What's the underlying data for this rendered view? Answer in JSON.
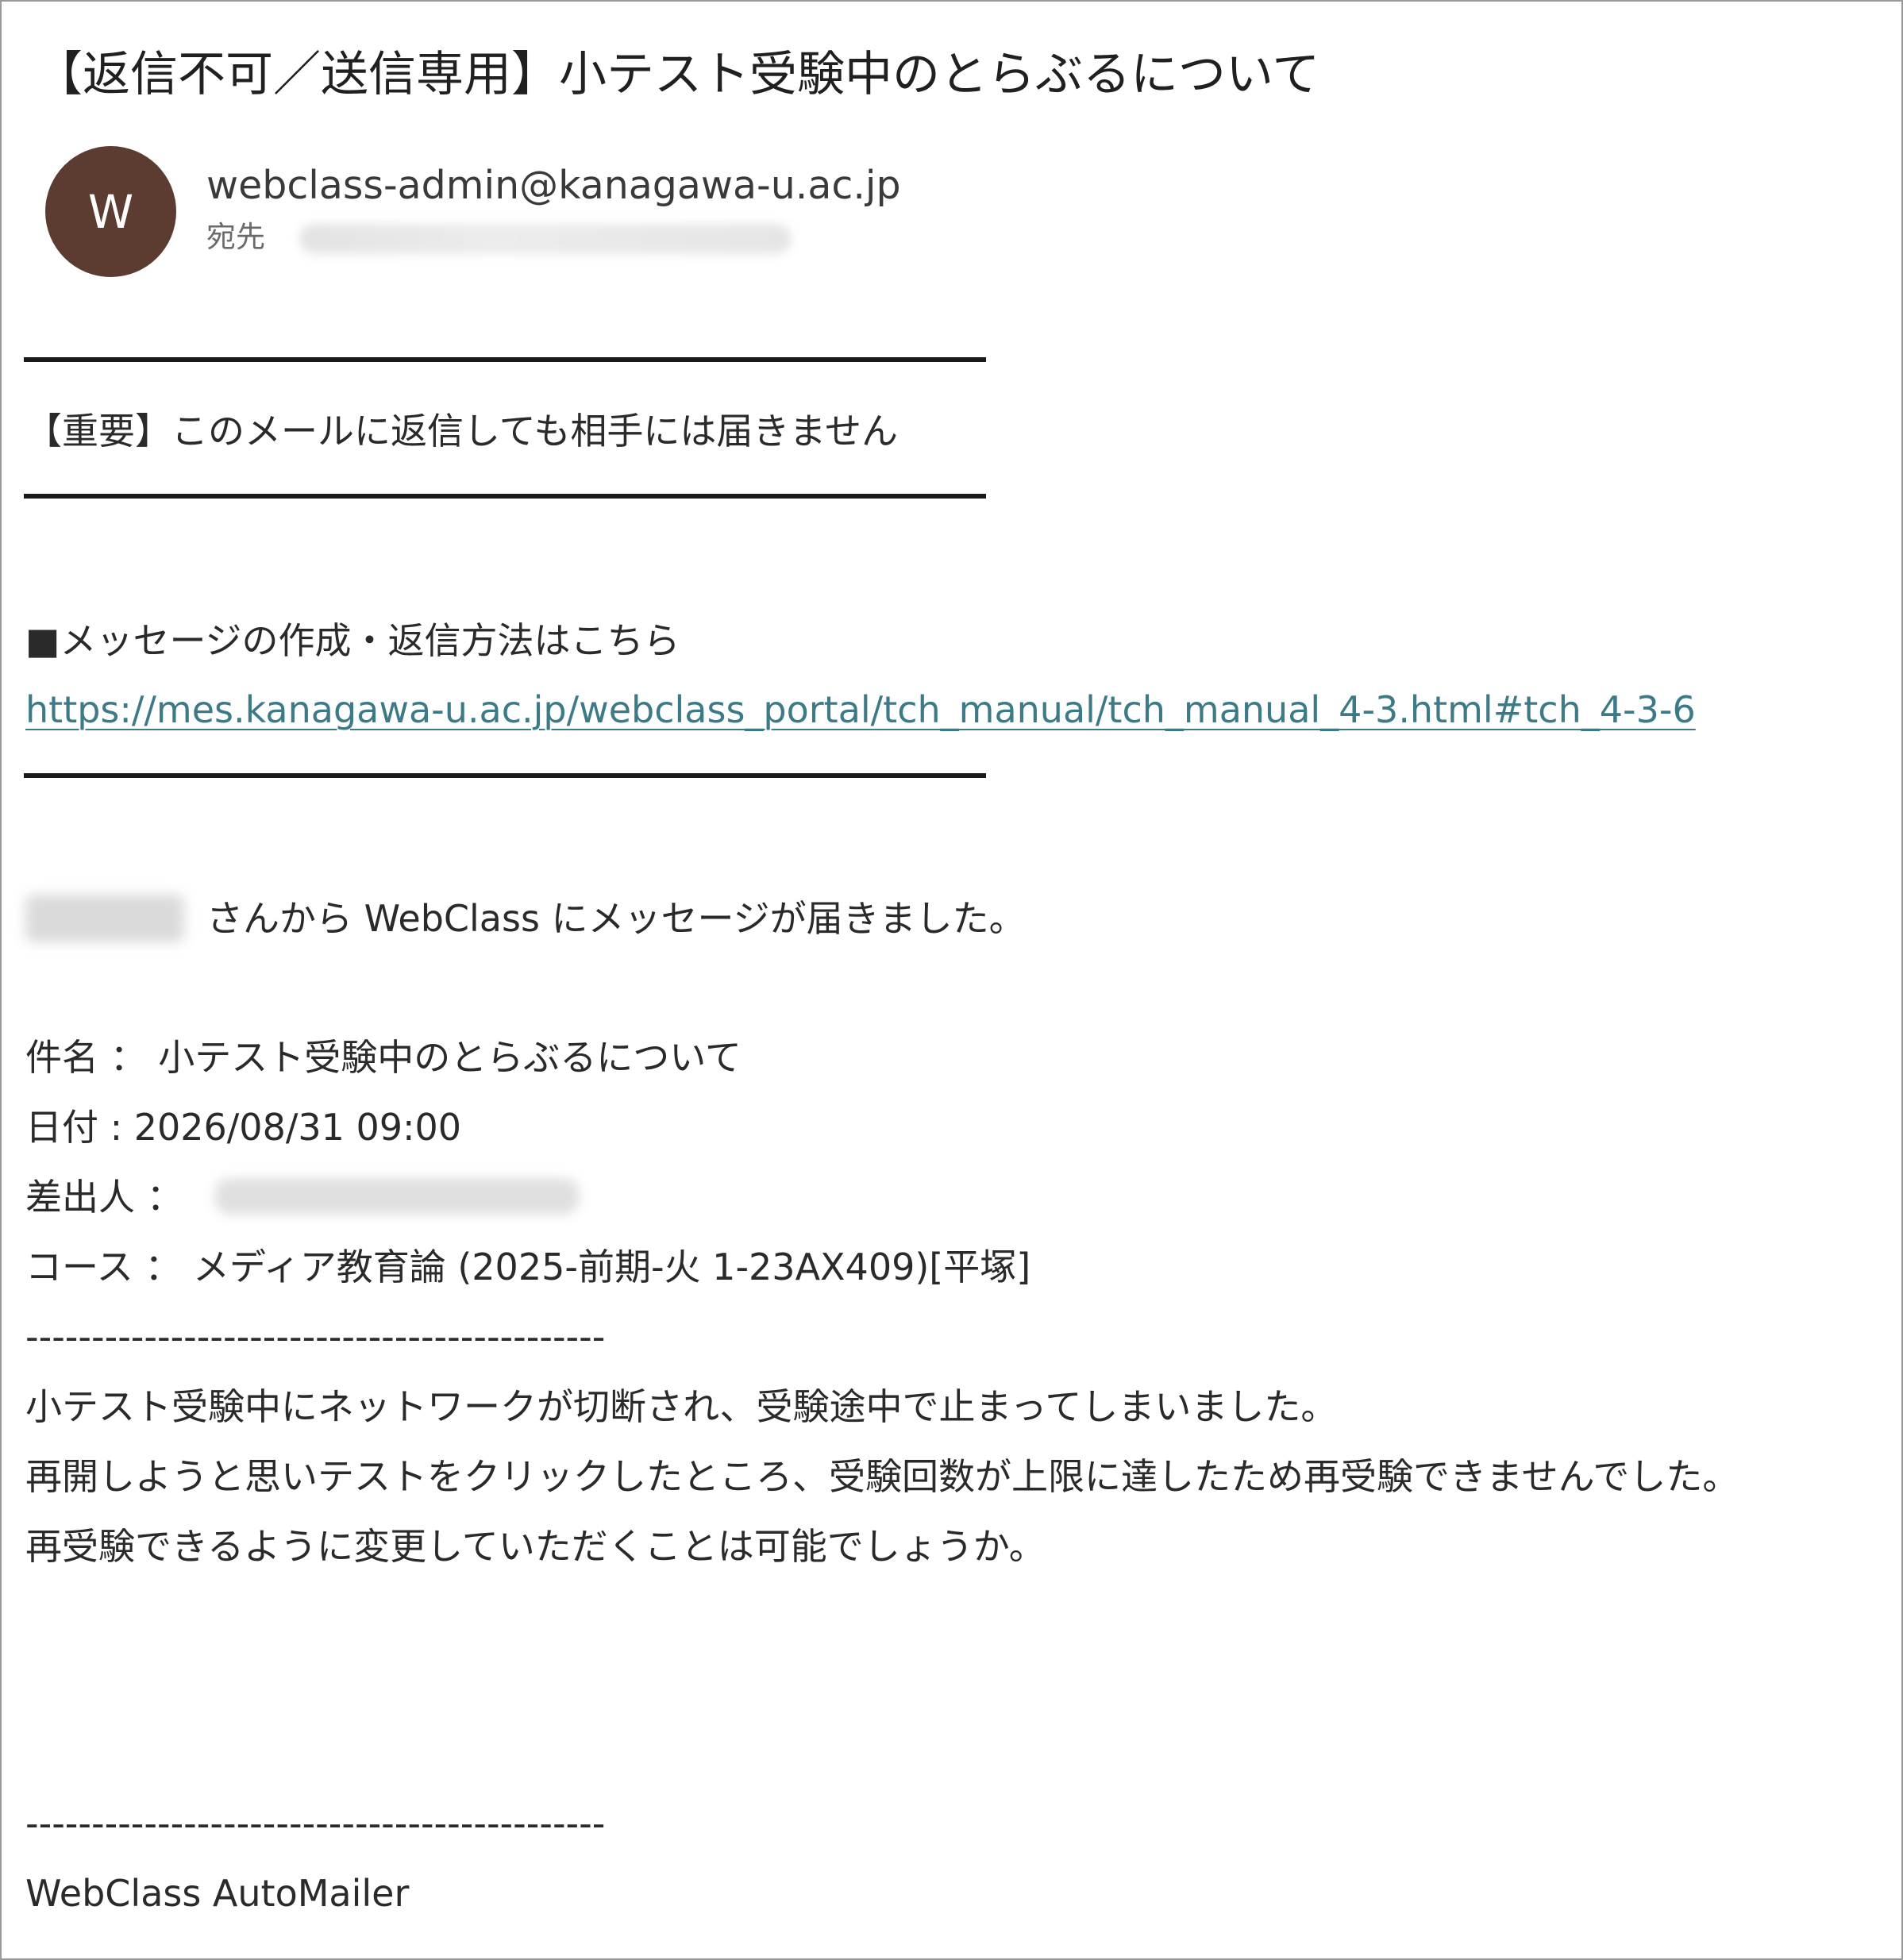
{
  "email": {
    "subject": "【返信不可／送信専用】小テスト受験中のとらぶるについて",
    "avatar_initial": "W",
    "sender": "webclass-admin@kanagawa-u.ac.jp",
    "to_label": "宛先"
  },
  "body": {
    "important_notice": "【重要】このメールに返信しても相手には届きません",
    "how_to_heading": "■メッセージの作成・返信方法はこちら",
    "help_link": "https://mes.kanagawa-u.ac.jp/webclass_portal/tch_manual/tch_manual_4-3.html#tch_4-3-6",
    "received_notice": "さんから WebClass にメッセージが届きました。",
    "subject_line": "件名 ： 小テスト受験中のとらぶるについて",
    "date_line": "日付 : 2026/08/31 09:00",
    "from_line": "差出人 ：",
    "course_line": "コース ： メディア教育論 (2025-前期-火 1-23AX409)[平塚]",
    "separator": "--------------------------------------------",
    "message_lines": [
      "小テスト受験中にネットワークが切断され、受験途中で止まってしまいました。",
      "再開しようと思いテストをクリックしたところ、受験回数が上限に達したため再受験できませんでした。",
      "再受験できるように変更していただくことは可能でしょうか。"
    ],
    "signature": "WebClass AutoMailer"
  },
  "colors": {
    "avatar_bg": "#5c3b30",
    "link": "#3b7a86",
    "rule": "#1a1a1a",
    "frame_border": "#9a9a9a"
  }
}
